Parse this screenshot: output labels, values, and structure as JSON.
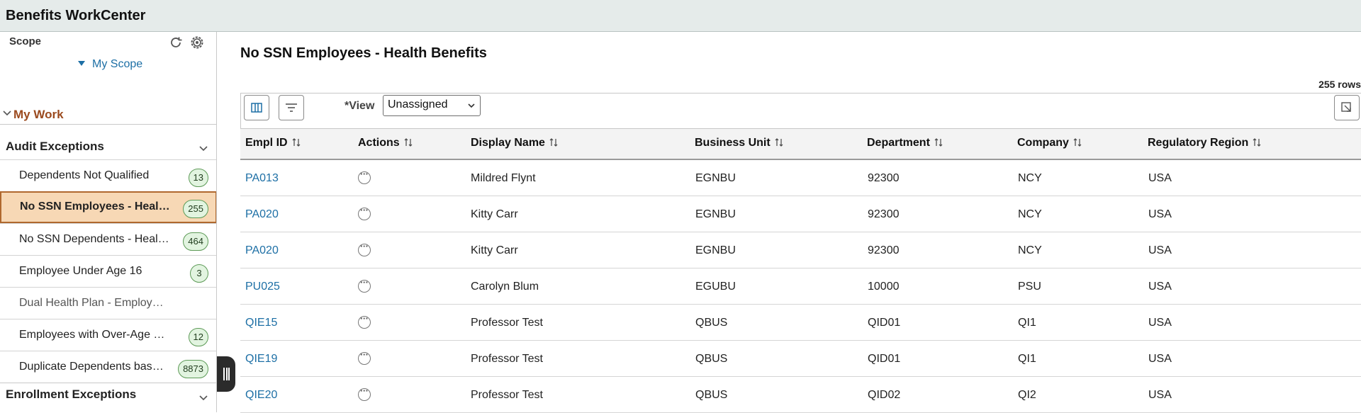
{
  "app": {
    "title": "Benefits WorkCenter"
  },
  "sidebar": {
    "scope_label": "Scope",
    "my_scope_link": "My Scope",
    "my_work_label": "My Work",
    "groups": [
      {
        "label": "Audit Exceptions",
        "items": [
          {
            "label": "Dependents Not Qualified",
            "count": "13",
            "active": false
          },
          {
            "label": "No SSN Employees - Health Benefits",
            "count": "255",
            "active": true
          },
          {
            "label": "No SSN Dependents - Health Benefits",
            "count": "464",
            "active": false
          },
          {
            "label": "Employee Under Age 16",
            "count": "3",
            "active": false
          },
          {
            "label": "Dual Health Plan - Employee Coverage",
            "count": "",
            "active": false
          },
          {
            "label": "Employees with Over-Age Dependents",
            "count": "12",
            "active": false
          },
          {
            "label": "Duplicate Dependents based on SSN",
            "count": "8873",
            "active": false
          }
        ]
      },
      {
        "label": "Enrollment Exceptions",
        "items": []
      }
    ]
  },
  "main": {
    "page_title": "No SSN Employees - Health Benefits",
    "row_count": "255 rows",
    "view_label": "*View",
    "view_value": "Unassigned",
    "columns": [
      "Empl ID",
      "Actions",
      "Display Name",
      "Business Unit",
      "Department",
      "Company",
      "Regulatory Region"
    ],
    "rows": [
      {
        "empl_id": "PA013",
        "display_name": "Mildred Flynt",
        "business_unit": "EGNBU",
        "department": "92300",
        "company": "NCY",
        "region": "USA"
      },
      {
        "empl_id": "PA020",
        "display_name": "Kitty Carr",
        "business_unit": "EGNBU",
        "department": "92300",
        "company": "NCY",
        "region": "USA"
      },
      {
        "empl_id": "PA020",
        "display_name": "Kitty Carr",
        "business_unit": "EGNBU",
        "department": "92300",
        "company": "NCY",
        "region": "USA"
      },
      {
        "empl_id": "PU025",
        "display_name": "Carolyn Blum",
        "business_unit": "EGUBU",
        "department": "10000",
        "company": "PSU",
        "region": "USA"
      },
      {
        "empl_id": "QIE15",
        "display_name": "Professor Test",
        "business_unit": "QBUS",
        "department": "QID01",
        "company": "QI1",
        "region": "USA"
      },
      {
        "empl_id": "QIE19",
        "display_name": "Professor Test",
        "business_unit": "QBUS",
        "department": "QID01",
        "company": "QI1",
        "region": "USA"
      },
      {
        "empl_id": "QIE20",
        "display_name": "Professor Test",
        "business_unit": "QBUS",
        "department": "QID02",
        "company": "QI2",
        "region": "USA"
      }
    ]
  },
  "colors": {
    "link": "#1d6fa5",
    "active_item_bg": "#f7d8b5",
    "my_work": "#9b4a1e",
    "badge_bg": "#e2f4e0"
  }
}
